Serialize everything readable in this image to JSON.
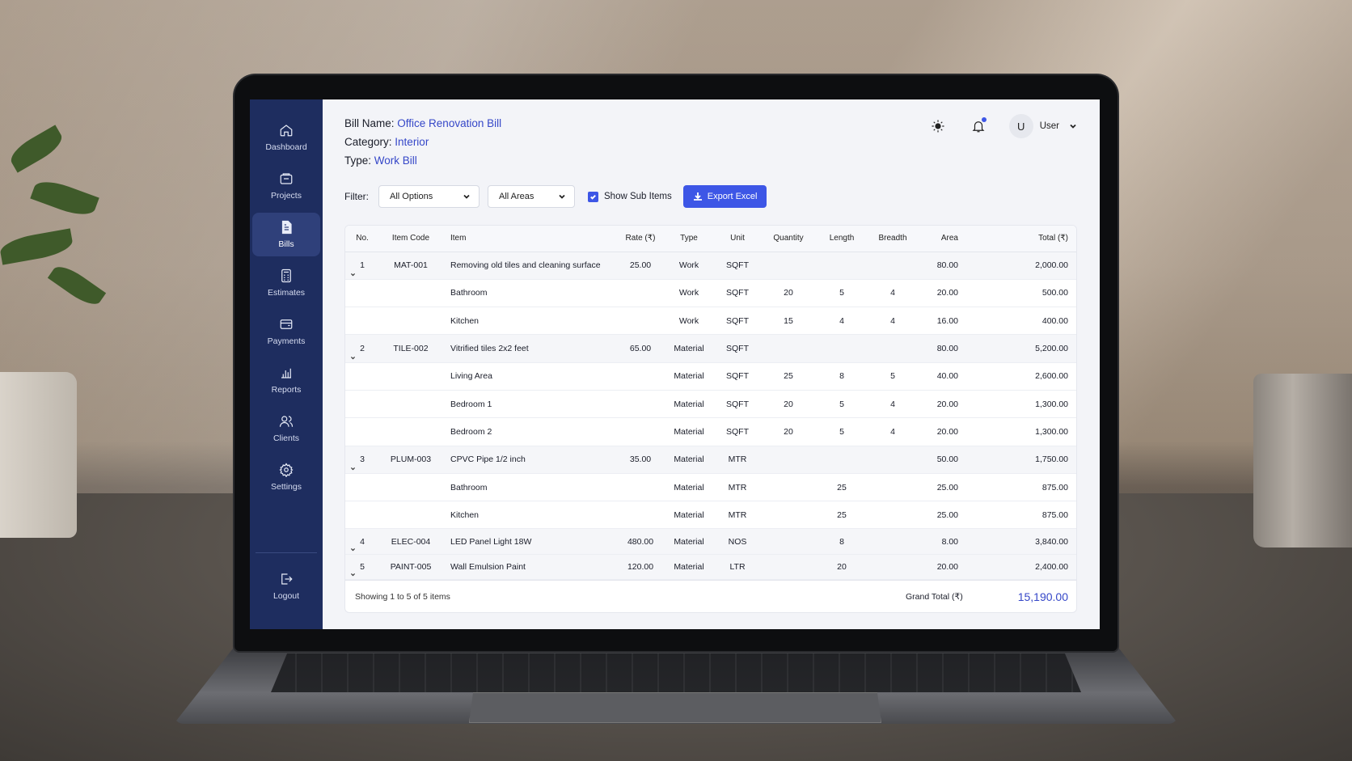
{
  "sidebar": {
    "items": [
      {
        "label": "Dashboard",
        "icon": "home-icon",
        "active": false
      },
      {
        "label": "Projects",
        "icon": "folder-icon",
        "active": false
      },
      {
        "label": "Bills",
        "icon": "document-icon",
        "active": true
      },
      {
        "label": "Estimates",
        "icon": "calculator-icon",
        "active": false
      },
      {
        "label": "Payments",
        "icon": "wallet-icon",
        "active": false
      },
      {
        "label": "Reports",
        "icon": "bar-chart-icon",
        "active": false
      },
      {
        "label": "Clients",
        "icon": "users-icon",
        "active": false
      },
      {
        "label": "Settings",
        "icon": "gear-icon",
        "active": false
      }
    ],
    "logout_label": "Logout"
  },
  "header": {
    "bill_name_key": "Bill Name:",
    "bill_name": "Office Renovation Bill",
    "category_key": "Category:",
    "category": "Interior",
    "type_key": "Type:",
    "type": "Work Bill",
    "avatar_letter": "U",
    "user_name": "User"
  },
  "filters": {
    "label": "Filter:",
    "options_value": "All Options",
    "areas_value": "All Areas",
    "show_sub_items_label": "Show Sub Items",
    "show_sub_items_checked": true,
    "export_label": "Export Excel"
  },
  "table": {
    "columns": [
      "No.",
      "Item Code",
      "Item",
      "Rate (₹)",
      "Type",
      "Unit",
      "Quantity",
      "Length",
      "Breadth",
      "Area",
      "Total (₹)"
    ],
    "rows": [
      {
        "kind": "parent",
        "no": "1",
        "code": "MAT-001",
        "item": "Removing old tiles and cleaning surface",
        "rate": "25.00",
        "type": "Work",
        "unit": "SQFT",
        "qty": "",
        "length": "",
        "breadth": "",
        "area": "80.00",
        "total": "2,000.00"
      },
      {
        "kind": "sub",
        "no": "",
        "code": "",
        "item": "Bathroom",
        "rate": "",
        "type": "Work",
        "unit": "SQFT",
        "qty": "20",
        "length": "5",
        "breadth": "4",
        "area": "20.00",
        "total": "500.00"
      },
      {
        "kind": "sub",
        "no": "",
        "code": "",
        "item": "Kitchen",
        "rate": "",
        "type": "Work",
        "unit": "SQFT",
        "qty": "15",
        "length": "4",
        "breadth": "4",
        "area": "16.00",
        "total": "400.00"
      },
      {
        "kind": "parent",
        "no": "2",
        "code": "TILE-002",
        "item": "Vitrified tiles 2x2 feet",
        "rate": "65.00",
        "type": "Material",
        "unit": "SQFT",
        "qty": "",
        "length": "",
        "breadth": "",
        "area": "80.00",
        "total": "5,200.00"
      },
      {
        "kind": "sub",
        "no": "",
        "code": "",
        "item": "Living Area",
        "rate": "",
        "type": "Material",
        "unit": "SQFT",
        "qty": "25",
        "length": "8",
        "breadth": "5",
        "area": "40.00",
        "total": "2,600.00"
      },
      {
        "kind": "sub",
        "no": "",
        "code": "",
        "item": "Bedroom 1",
        "rate": "",
        "type": "Material",
        "unit": "SQFT",
        "qty": "20",
        "length": "5",
        "breadth": "4",
        "area": "20.00",
        "total": "1,300.00"
      },
      {
        "kind": "sub",
        "no": "",
        "code": "",
        "item": "Bedroom 2",
        "rate": "",
        "type": "Material",
        "unit": "SQFT",
        "qty": "20",
        "length": "5",
        "breadth": "4",
        "area": "20.00",
        "total": "1,300.00"
      },
      {
        "kind": "parent",
        "no": "3",
        "code": "PLUM-003",
        "item": "CPVC Pipe 1/2 inch",
        "rate": "35.00",
        "type": "Material",
        "unit": "MTR",
        "qty": "",
        "length": "",
        "breadth": "",
        "area": "50.00",
        "total": "1,750.00"
      },
      {
        "kind": "sub",
        "no": "",
        "code": "",
        "item": "Bathroom",
        "rate": "",
        "type": "Material",
        "unit": "MTR",
        "qty": "",
        "length": "25",
        "breadth": "",
        "area": "25.00",
        "total": "875.00"
      },
      {
        "kind": "sub",
        "no": "",
        "code": "",
        "item": "Kitchen",
        "rate": "",
        "type": "Material",
        "unit": "MTR",
        "qty": "",
        "length": "25",
        "breadth": "",
        "area": "25.00",
        "total": "875.00"
      },
      {
        "kind": "parent",
        "no": "4",
        "code": "ELEC-004",
        "item": "LED Panel Light 18W",
        "rate": "480.00",
        "type": "Material",
        "unit": "NOS",
        "qty": "",
        "length": "8",
        "breadth": "",
        "area": "8.00",
        "total": "3,840.00"
      },
      {
        "kind": "parent",
        "no": "5",
        "code": "PAINT-005",
        "item": "Wall Emulsion Paint",
        "rate": "120.00",
        "type": "Material",
        "unit": "LTR",
        "qty": "",
        "length": "20",
        "breadth": "",
        "area": "20.00",
        "total": "2,400.00"
      }
    ],
    "footer_text": "Showing 1 to 5 of 5 items",
    "grand_total_label": "Grand Total (₹)",
    "grand_total": "15,190.00"
  },
  "colors": {
    "sidebar_bg": "#1e2d5f",
    "accent": "#3d56e6",
    "link_text": "#3547c8"
  }
}
